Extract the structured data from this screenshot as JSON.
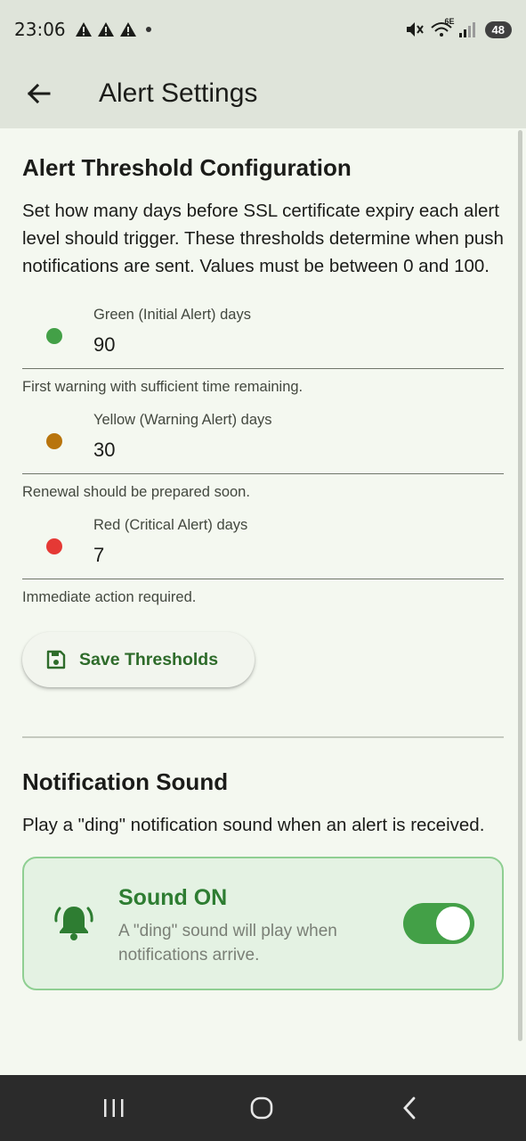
{
  "status_bar": {
    "time": "23:06",
    "battery": "48",
    "network_label": "6E"
  },
  "app_bar": {
    "title": "Alert Settings"
  },
  "threshold_section": {
    "title": "Alert Threshold Configuration",
    "description": "Set how many days before SSL certificate expiry each alert level should trigger. These thresholds determine when push notifications are sent. Values must be between 0 and 100.",
    "fields": [
      {
        "label": "Green (Initial Alert) days",
        "value": "90",
        "helper": "First warning with sufficient time remaining.",
        "color": "#43a047"
      },
      {
        "label": "Yellow (Warning Alert) days",
        "value": "30",
        "helper": "Renewal should be prepared soon.",
        "color": "#b8740c"
      },
      {
        "label": "Red (Critical Alert) days",
        "value": "7",
        "helper": "Immediate action required.",
        "color": "#e53935"
      }
    ],
    "save_label": "Save Thresholds"
  },
  "sound_section": {
    "title": "Notification Sound",
    "description": "Play a \"ding\" notification sound when an alert is received.",
    "card_title": "Sound ON",
    "card_subtitle": "A \"ding\" sound will play when notifications arrive.",
    "toggle_on": true
  },
  "colors": {
    "accent": "#2e7d32",
    "app_bar_bg": "#dfe4da",
    "page_bg": "#f4f8f0"
  }
}
